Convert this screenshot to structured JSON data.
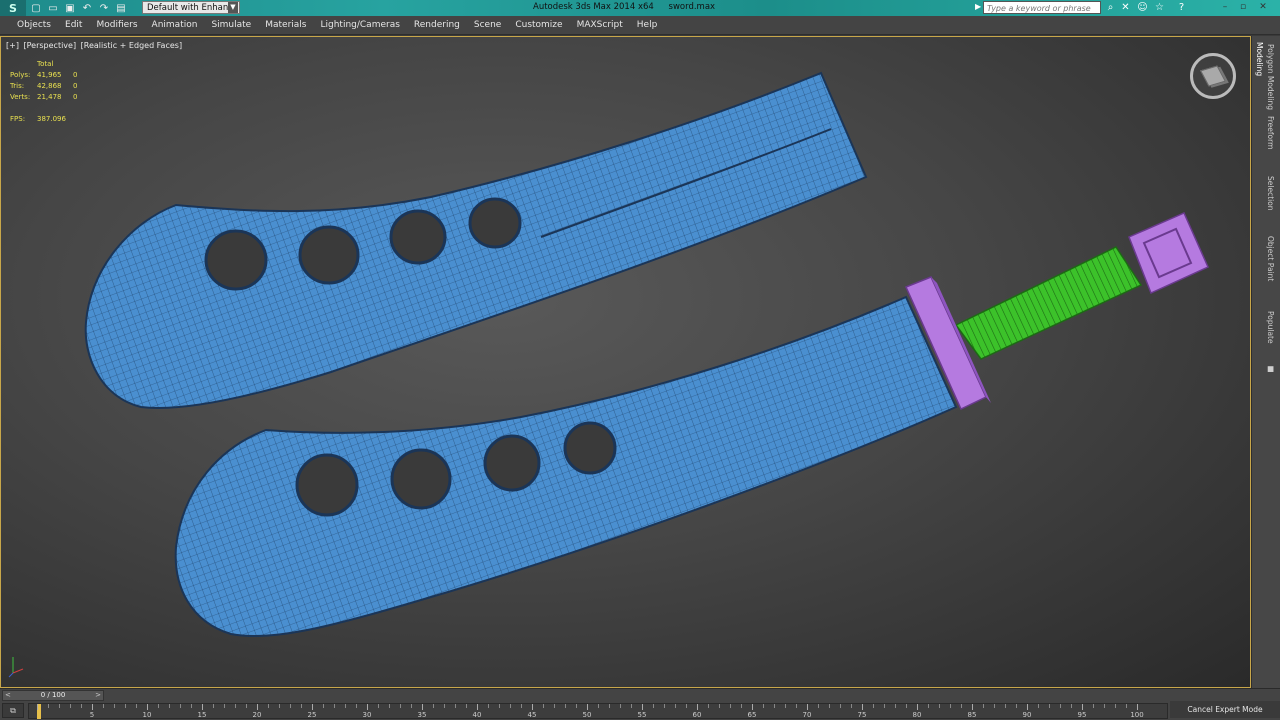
{
  "titlebar": {
    "app_title": "Autodesk 3ds Max  2014 x64",
    "file_name": "sword.max",
    "workspace": "Default with Enhance",
    "search_placeholder": "Type a keyword or phrase",
    "colors": {
      "bar": "#1e8b8b"
    }
  },
  "menu": [
    "Objects",
    "Edit",
    "Modifiers",
    "Animation",
    "Simulate",
    "Materials",
    "Lighting/Cameras",
    "Rendering",
    "Scene",
    "Customize",
    "MAXScript",
    "Help"
  ],
  "viewport": {
    "label": [
      "[+]",
      "[Perspective]",
      "[Realistic + Edged Faces]"
    ],
    "stats": {
      "header": "Total",
      "rows": [
        {
          "k": "Polys:",
          "v": "41,965",
          "z": "0"
        },
        {
          "k": "Tris:",
          "v": "42,868",
          "z": "0"
        },
        {
          "k": "Verts:",
          "v": "21,478",
          "z": "0"
        }
      ],
      "fps_label": "FPS:",
      "fps_value": "387.096"
    },
    "colors": {
      "blade": "#4a8fd0",
      "guard": "#b57ae0",
      "grip": "#3cc22a",
      "stats_text": "#e9e050",
      "border": "#c8a74a"
    }
  },
  "ribbon_tabs": [
    "Modeling",
    "Polygon Modeling",
    "Freeform",
    "Selection",
    "Object Paint",
    "Populate"
  ],
  "timeline": {
    "frame_label": "0 / 100",
    "prev": "<",
    "next": ">",
    "ticks": [
      "5",
      "10",
      "15",
      "20",
      "25",
      "30",
      "35",
      "40",
      "45",
      "50",
      "55",
      "60",
      "65",
      "70",
      "75",
      "80",
      "85",
      "90",
      "95",
      "100"
    ],
    "cancel_expert": "Cancel Expert Mode"
  }
}
